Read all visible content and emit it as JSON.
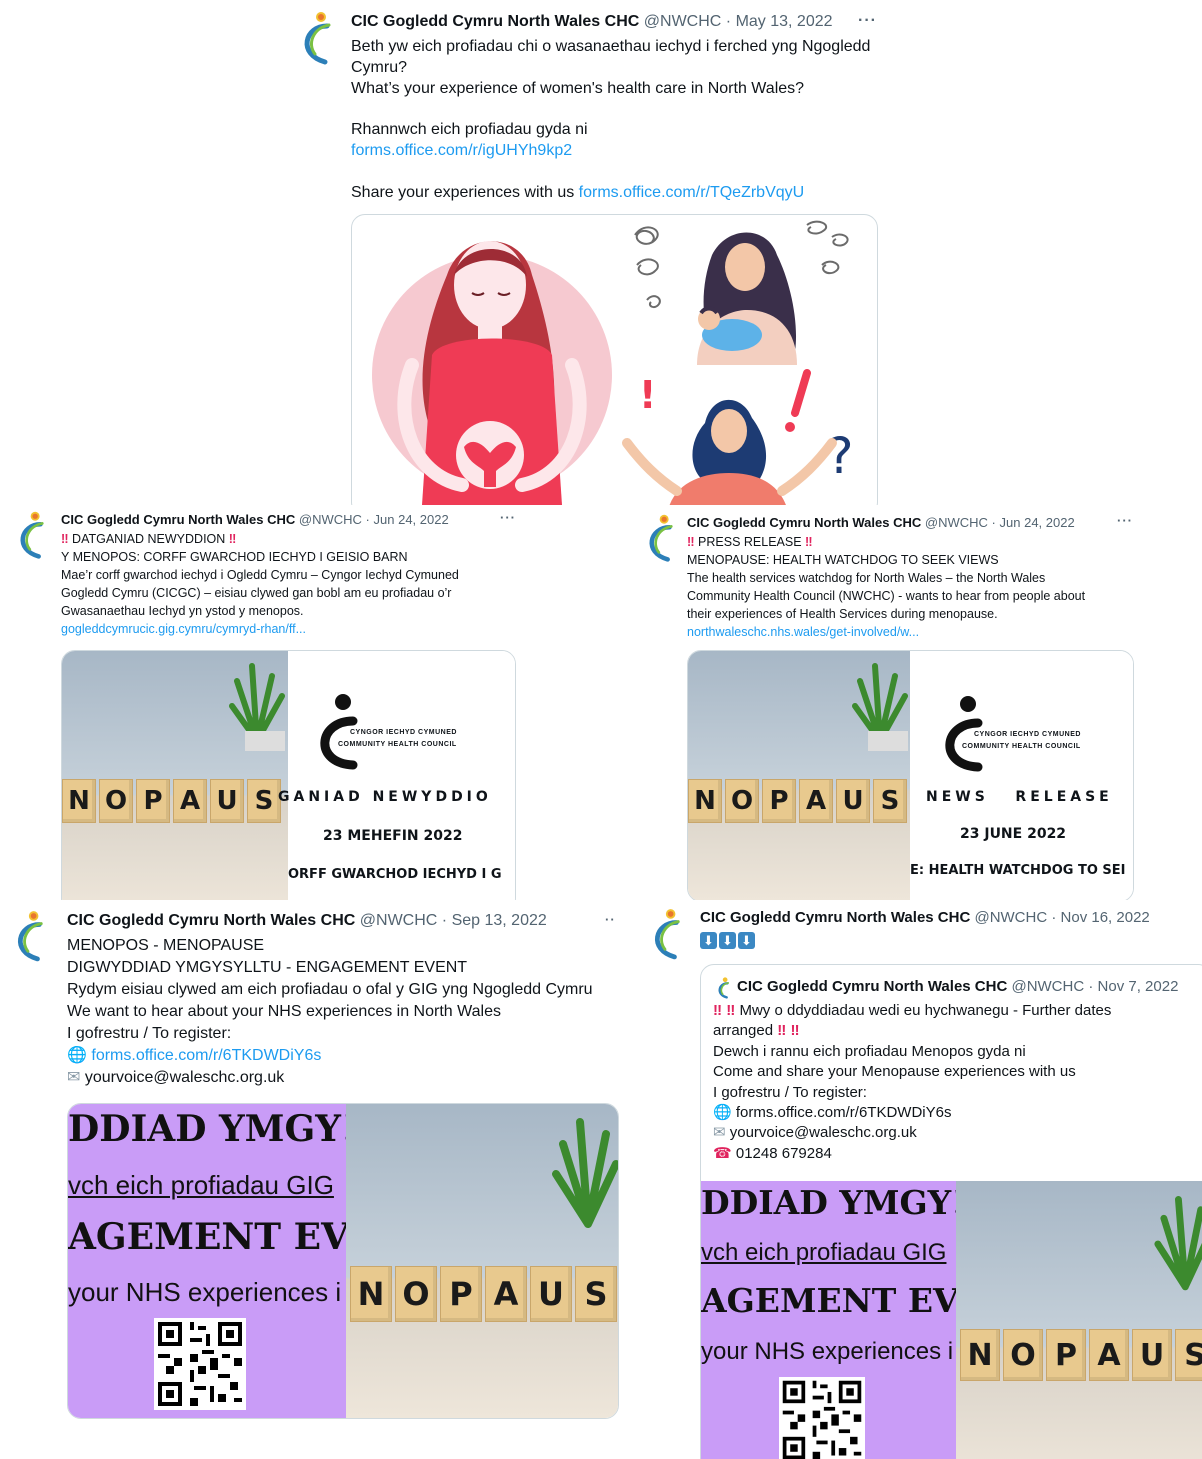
{
  "account": {
    "name": "CIC Gogledd Cymru North Wales CHC",
    "handle": "@NWCHC"
  },
  "colors": {
    "link": "#1d9bf0",
    "meta": "#536471",
    "purple": "#c99cf7",
    "pink": "#f6c9d0",
    "dress": "#ef3b55",
    "hair": "#b8363f"
  },
  "tweet1": {
    "date": "May 13, 2022",
    "line1": "Beth yw eich profiadau chi o wasanaethau iechyd i ferched yng Ngogledd",
    "line2": "Cymru?",
    "line3": "What’s your experience of women's health care in North Wales?",
    "line4": "Rhannwch eich profiadau gyda ni",
    "link1": "forms.office.com/r/igUHYh9kp2",
    "line5": "Share your experiences with us ",
    "link2": "forms.office.com/r/TQeZrbVqyU",
    "question_mark": "?"
  },
  "tweet2": {
    "date": "Jun 24, 2022",
    "headline": "DATGANIAD NEWYDDION",
    "body": "Y MENOPOS:  CORFF GWARCHOD IECHYD I GEISIO BARN\nMae’r corff gwarchod iechyd i Ogledd Cymru – Cyngor Iechyd Cymuned\nGogledd Cymru (CICGC) – eisiau clywed gan bobl am eu profiadau o’r\nGwasanaethau Iechyd yn ystod y menopos.",
    "link": "gogleddcymrucic.gig.cymru/cymryd-rhan/ff...",
    "card": {
      "blocks": [
        "N",
        "O",
        "P",
        "A",
        "U",
        "S"
      ],
      "logo_line1": "CYNGOR IECHYD CYMUNED",
      "logo_line2": "COMMUNITY HEALTH COUNCIL",
      "press": "GANIAD NEWYDDIO",
      "date": "23 MEHEFIN 2022",
      "footer": "ORFF GWARCHOD IECHYD I G"
    }
  },
  "tweet3": {
    "date": "Jun 24, 2022",
    "headline": "PRESS RELEASE",
    "body": "MENOPAUSE:  HEALTH WATCHDOG TO SEEK VIEWS\nThe health services watchdog for North Wales – the North Wales\nCommunity Health Council (NWCHC) - wants to hear from people about\ntheir experiences of Health Services during menopause.",
    "link": "northwaleschc.nhs.wales/get-involved/w...",
    "card": {
      "blocks": [
        "N",
        "O",
        "P",
        "A",
        "U",
        "S"
      ],
      "logo_line1": "CYNGOR IECHYD CYMUNED",
      "logo_line2": "COMMUNITY HEALTH COUNCIL",
      "press": "NEWS   RELEASE",
      "date": "23 JUNE 2022",
      "footer": "E:  HEALTH WATCHDOG TO SEI"
    }
  },
  "tweet4": {
    "date": "Sep 13, 2022",
    "l1": "MENOPOS - MENOPAUSE",
    "l2": "DIGWYDDIAD YMGYSYLLTU - ENGAGEMENT EVENT",
    "l3": "Rydym eisiau clywed am eich profiadau o ofal y GIG yng Ngogledd Cymru",
    "l4": "We want to hear about your NHS experiences in North Wales",
    "l5": "I gofrestru / To register:",
    "link": "forms.office.com/r/6TKDWDiY6s",
    "email": "yourvoice@waleschc.org.uk",
    "poster": {
      "p1": "DDIAD YMGY!",
      "p2": "vch eich profiadau GIG",
      "p3": "AGEMENT EV",
      "p4": "your NHS experiences i"
    },
    "blocks": [
      "N",
      "O",
      "P",
      "A",
      "U",
      "S"
    ]
  },
  "tweet5": {
    "date": "Nov 16, 2022",
    "quote": {
      "date": "Nov 7, 2022",
      "l1a": "Mwy o ddyddiadau wedi eu hychwanegu  - Further dates",
      "l1b": "arranged",
      "l2": "Dewch i rannu eich profiadau Menopos gyda ni",
      "l3": "Come and share your Menopause experiences with us",
      "l4": "I gofrestru / To register:",
      "link": "forms.office.com/r/6TKDWDiY6s",
      "email": "yourvoice@waleschc.org.uk",
      "phone": "01248 679284"
    },
    "poster": {
      "p1": "DDIAD YMGY!",
      "p2": "vch eich profiadau GIG",
      "p3": "AGEMENT EV",
      "p4": "your NHS experiences i"
    },
    "blocks": [
      "N",
      "O",
      "P",
      "A",
      "U",
      "S"
    ]
  }
}
